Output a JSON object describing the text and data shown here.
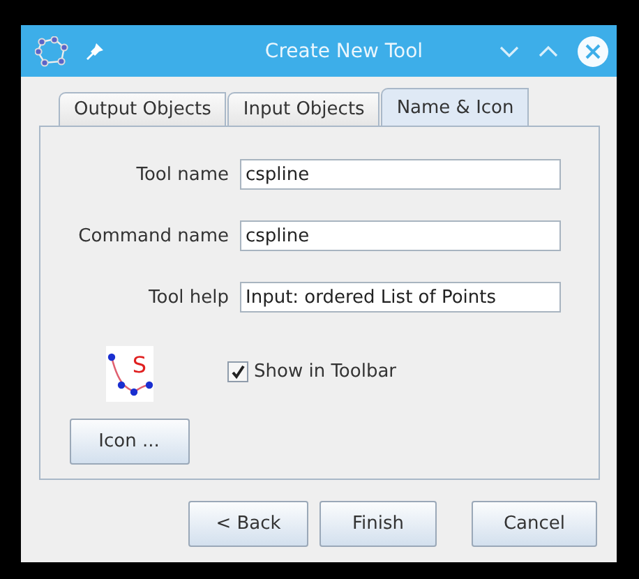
{
  "window": {
    "title": "Create New Tool"
  },
  "tabs": [
    {
      "label": "Output Objects",
      "selected": false
    },
    {
      "label": "Input Objects",
      "selected": false
    },
    {
      "label": "Name & Icon",
      "selected": true
    }
  ],
  "fields": [
    {
      "label": "Tool name",
      "value": "cspline"
    },
    {
      "label": "Command name",
      "value": "cspline"
    },
    {
      "label": "Tool help",
      "value": "Input: ordered List of Points"
    }
  ],
  "tool_icon": {
    "letter": "S"
  },
  "show_in_toolbar": {
    "label": "Show in Toolbar",
    "checked": true
  },
  "icon_button": "Icon ...",
  "buttons": [
    "< Back",
    "Finish",
    "Cancel"
  ]
}
